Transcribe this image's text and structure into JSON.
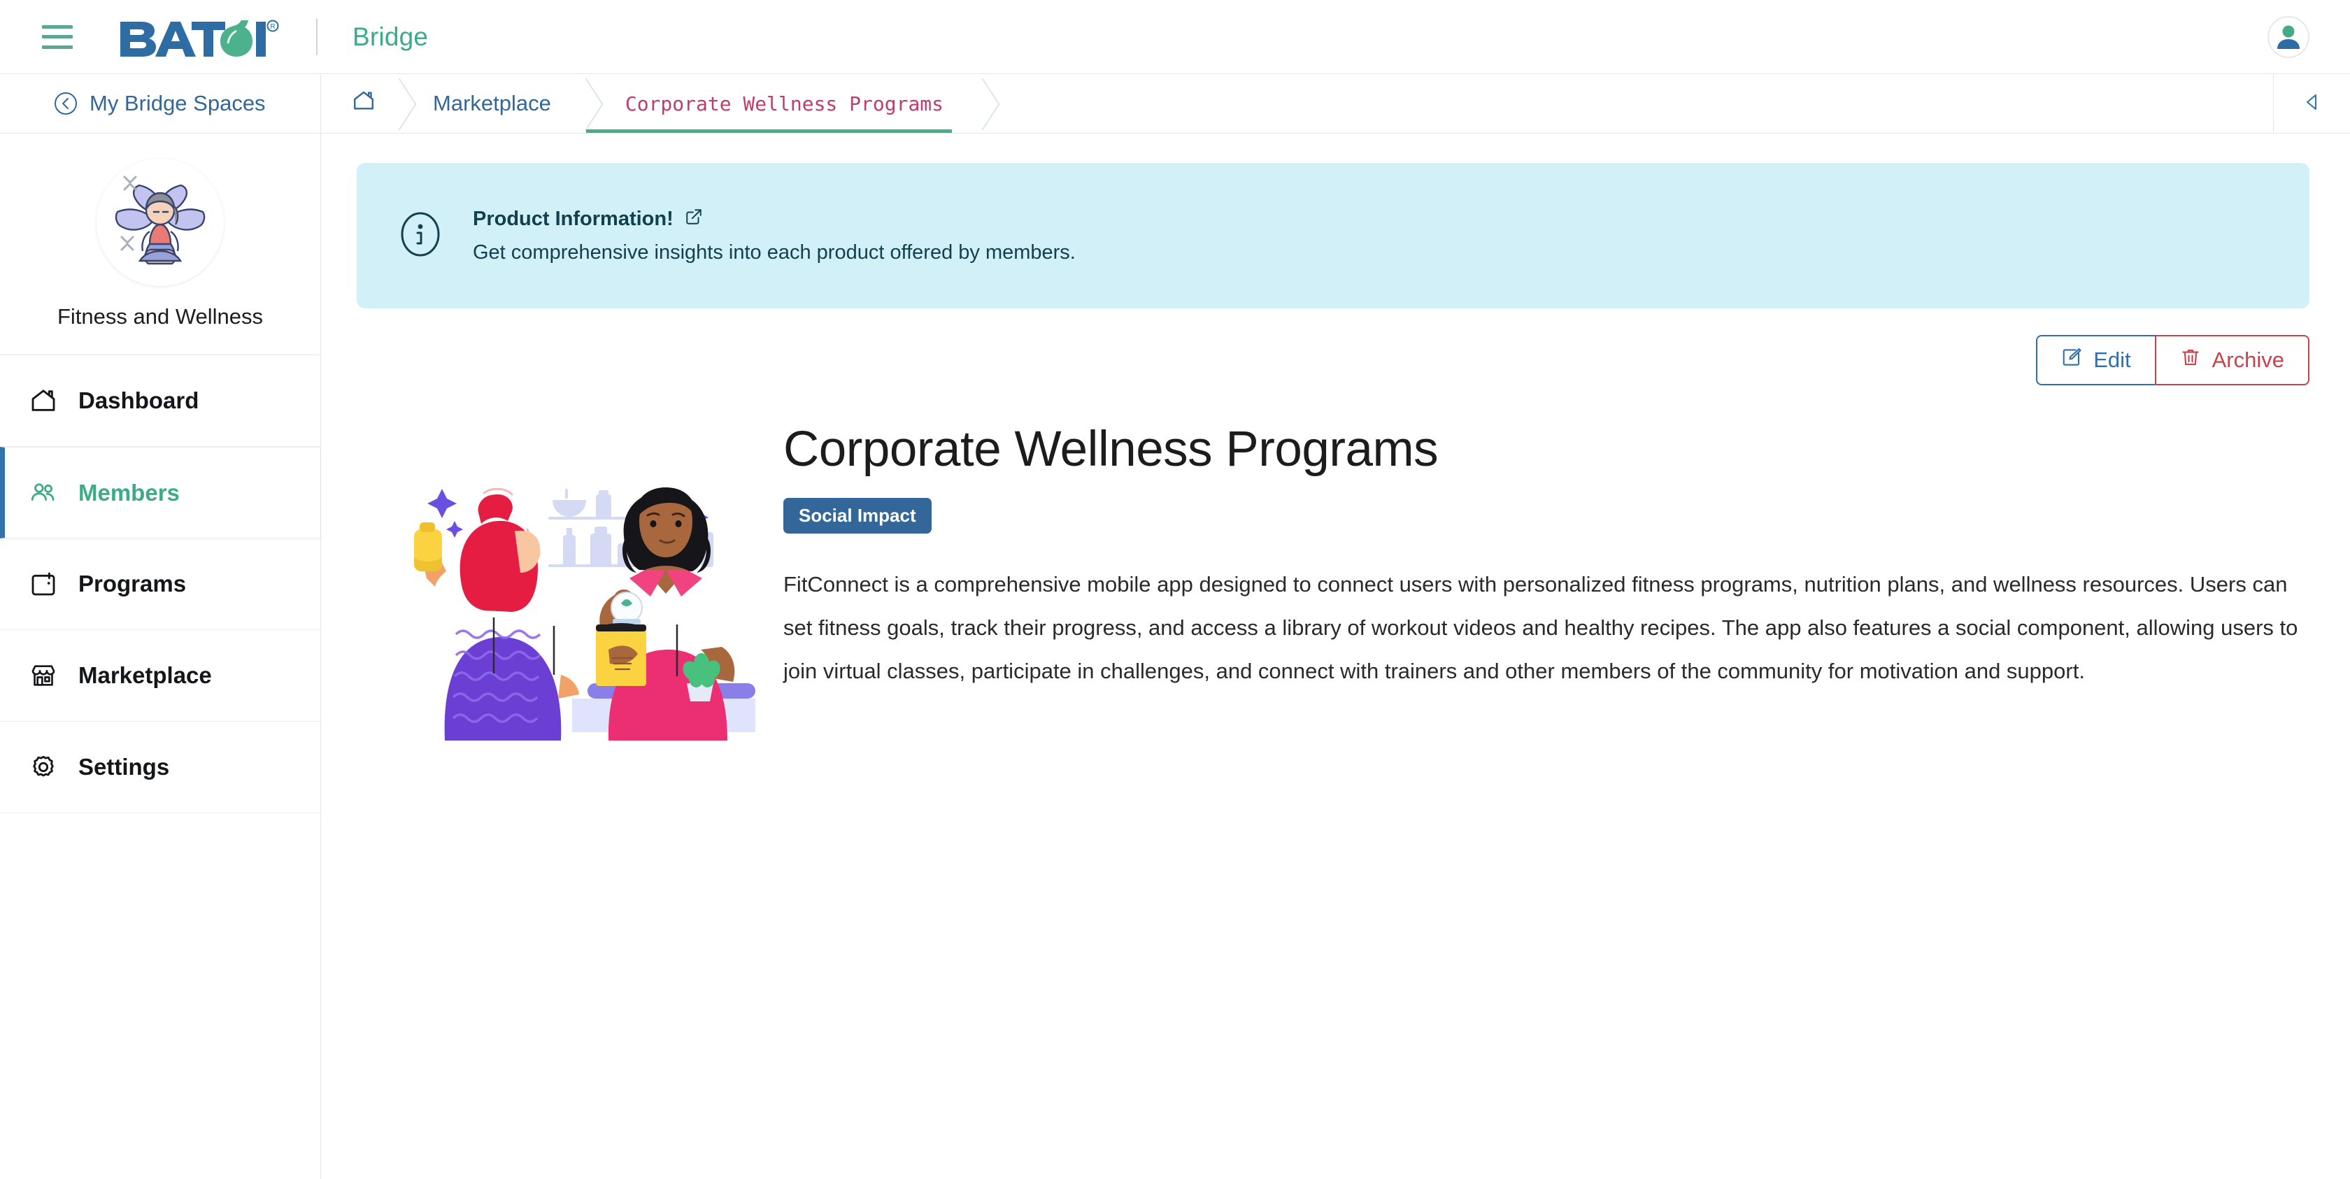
{
  "header": {
    "menu_icon": "hamburger-icon",
    "brand_name": "BATOI",
    "brand_trademark": "®",
    "app_name": "Bridge",
    "avatar_icon": "user-avatar-icon"
  },
  "breadcrumb_bar": {
    "back_label": "My Bridge Spaces",
    "back_icon": "circle-arrow-left-icon",
    "home_icon": "home-icon",
    "items": [
      {
        "label": "Marketplace",
        "active": false
      },
      {
        "label": "Corporate Wellness Programs",
        "active": true
      }
    ],
    "collapse_icon": "caret-left-icon"
  },
  "sidebar": {
    "space_name": "Fitness and Wellness",
    "space_avatar_icon": "yoga-meditation-avatar",
    "items": [
      {
        "label": "Dashboard",
        "icon": "home-icon",
        "active": false
      },
      {
        "label": "Members",
        "icon": "people-icon",
        "active": true
      },
      {
        "label": "Programs",
        "icon": "calendar-icon",
        "active": false
      },
      {
        "label": "Marketplace",
        "icon": "store-icon",
        "active": false
      },
      {
        "label": "Settings",
        "icon": "gear-icon",
        "active": false
      }
    ]
  },
  "info_banner": {
    "icon": "info-circle-icon",
    "title": "Product Information!",
    "link_icon": "external-link-icon",
    "subtitle": "Get comprehensive insights into each product offered by members."
  },
  "actions": {
    "edit_label": "Edit",
    "edit_icon": "pencil-square-icon",
    "archive_label": "Archive",
    "archive_icon": "trash-icon"
  },
  "product": {
    "illustration_icon": "wellness-store-illustration",
    "title": "Corporate Wellness Programs",
    "tag": "Social Impact",
    "description": "FitConnect is a comprehensive mobile app designed to connect users with personalized fitness programs, nutrition plans, and wellness resources. Users can set fitness goals, track their progress, and access a library of workout videos and healthy recipes. The app also features a social component, allowing users to join virtual classes, participate in challenges, and connect with trainers and other members of the community for motivation and support."
  },
  "colors": {
    "brand_blue": "#2e6da4",
    "brand_green": "#3cac86",
    "accent_pink": "#bf3d6e",
    "breadcrumb_blue": "#336699",
    "info_bg": "#d2f0f7",
    "info_text": "#11414f",
    "danger_red": "#c8414b",
    "active_border": "#3273ab"
  }
}
